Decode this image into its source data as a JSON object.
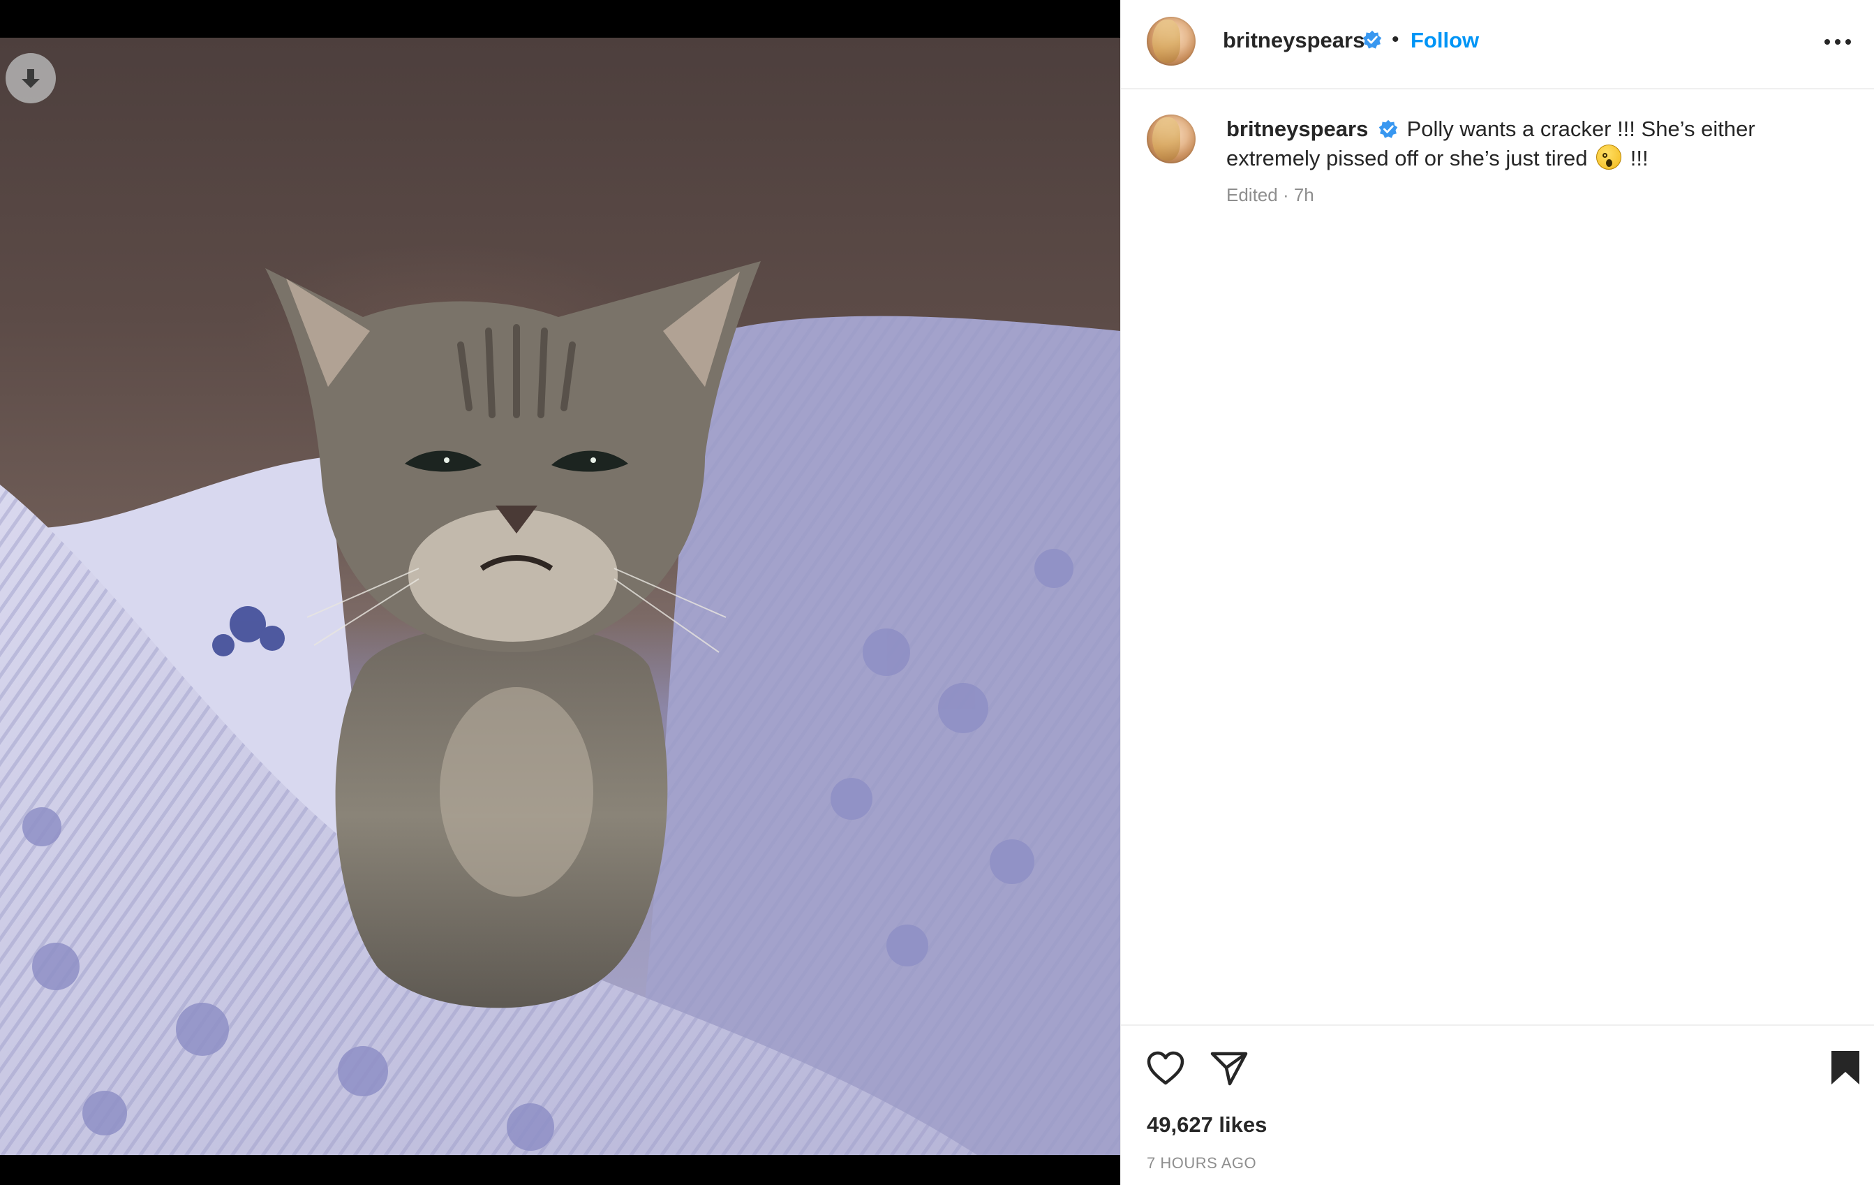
{
  "post": {
    "username": "britneyspears",
    "verified": true,
    "follow_label": "Follow",
    "header_separator": "•",
    "caption_text": "Polly wants a cracker !!! She’s either extremely pissed off or she’s just tired",
    "caption_suffix": "!!!",
    "caption_emoji": "sleepy-face-emoji",
    "edited_label": "Edited",
    "meta_separator": " · ",
    "age_short": "7h",
    "likes": "49,627 likes",
    "timestamp": "7 HOURS AGO"
  },
  "media": {
    "subject": "gray tabby kitten on striped floral bedding",
    "download_icon": "arrow-down-icon"
  },
  "icons": {
    "more": "more-horizontal-icon",
    "like": "heart-outline-icon",
    "share": "paper-plane-icon",
    "save": "bookmark-filled-icon",
    "verified": "verified-badge-icon"
  },
  "colors": {
    "accent": "#0095f6",
    "verified": "#3897f0",
    "text": "#262626",
    "secondary_text": "#8e8e8e",
    "divider": "#efefef"
  }
}
